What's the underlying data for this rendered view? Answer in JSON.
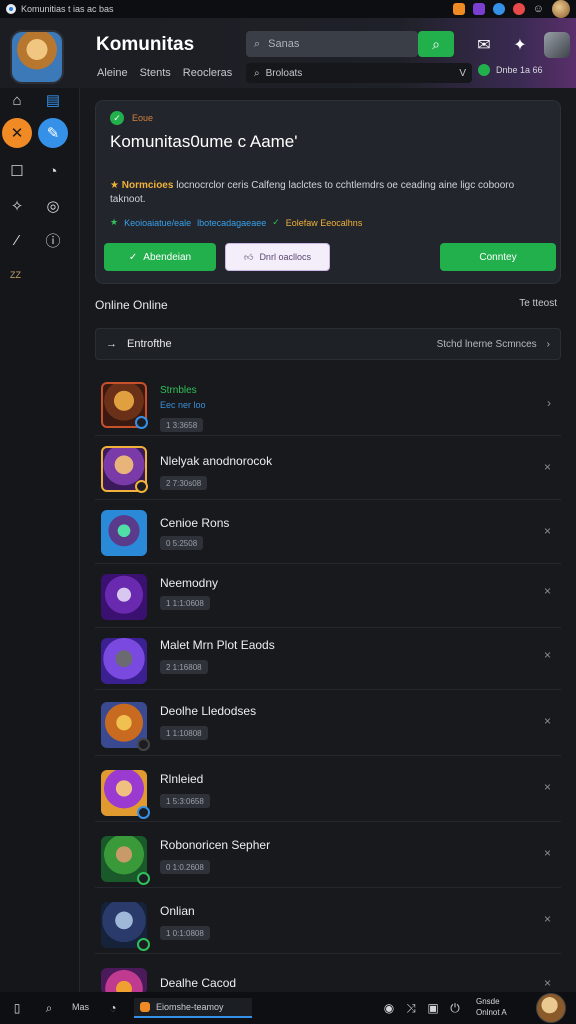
{
  "statusbar": {
    "title": "Komunitias t ias ac bas",
    "accent": "#f08a24"
  },
  "header": {
    "app_title": "Komunitas",
    "nav": [
      "Aleine",
      "Stents",
      "Reocleras"
    ],
    "search_placeholder": "Sanas",
    "filter_label": "Broloats",
    "filter_value": "V",
    "badge_text": "Dnbe 1a 66"
  },
  "sidebar": {
    "footer_label": "ZZ"
  },
  "hero": {
    "verified_label": "Eoue",
    "title": "Komunitas0ume c Aame'",
    "desc_bold": "Normcioes",
    "desc_text": " locnocrclor ceris  Calfeng laclctes to cchtlemdrs oe ceading aine ligc cobooro taknoot.",
    "tag_1": "Keoioaiatue/eale",
    "tag_2": "lbotecadagaeaee",
    "tag_3": "Eolefaw  Eeocalhns",
    "btn_primary": "Abendeian",
    "btn_secondary": "Dnrl oacllocs",
    "btn_right": "Conntey"
  },
  "section": {
    "title": "Online Online",
    "right": "Te tteost",
    "subbar_left": "Entrofthe",
    "subbar_right": "Stchd lnerne  Scmnces"
  },
  "rows": [
    {
      "title": "Strnbles",
      "sub": "Eec ner  loo",
      "pill": "1 3:3658",
      "title_color": "#2fc05a",
      "close": "›"
    },
    {
      "title": "Nlelyak anodnorocok",
      "sub": "",
      "pill": "2 7:30s08",
      "close": "×"
    },
    {
      "title": "Cenioe Rons",
      "sub": "",
      "pill": "0 5:2508",
      "close": "×"
    },
    {
      "title": "Neemodny",
      "sub": "",
      "pill": "1 1:1:0608",
      "close": "×"
    },
    {
      "title": "Malet Mrn Plot Eaods",
      "sub": "",
      "pill": "2 1:16808",
      "close": "×"
    },
    {
      "title": "Deolhe Lledodses",
      "sub": "",
      "pill": "1 1:10808",
      "close": "×"
    },
    {
      "title": "Rlnleied",
      "sub": "",
      "pill": "1 5:3:0658",
      "close": "×"
    },
    {
      "title": "Robonoricen Sepher",
      "sub": "",
      "pill": "0 1:0.2608",
      "close": "×"
    },
    {
      "title": "Onlian",
      "sub": "",
      "pill": "1 0:1:0808",
      "close": "×"
    },
    {
      "title": "Dealhe Cacod",
      "sub": "",
      "pill": "",
      "close": "×"
    }
  ],
  "taskbar": {
    "label_1": "Mas",
    "active_label": "Eiomshe-teamoy",
    "clock_1": "Gnsde",
    "clock_2": "Onlnot A"
  }
}
